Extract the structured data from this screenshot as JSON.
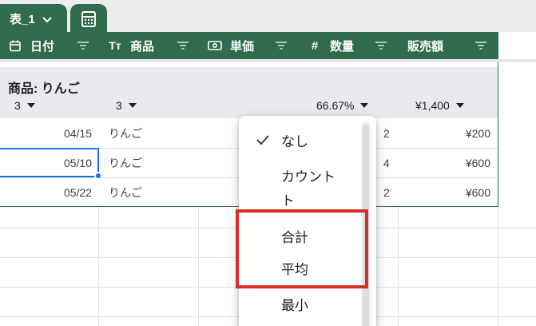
{
  "tab": {
    "name": "表_1"
  },
  "columns": [
    {
      "name": "日付",
      "icon": "calendar-icon"
    },
    {
      "name": "商品",
      "icon": "text-type-icon",
      "icon_text": "Tт"
    },
    {
      "name": "単価",
      "icon": "money-icon"
    },
    {
      "name": "数量",
      "icon": "number-icon",
      "icon_text": "#"
    },
    {
      "name": "販売額",
      "icon": "none"
    }
  ],
  "group": {
    "title": "商品: りんご",
    "agg_date": "3",
    "agg_item": "3",
    "agg_qty": "66.67%",
    "agg_sales": "¥1,400"
  },
  "rows": [
    {
      "date": "04/15",
      "item": "りんご",
      "qty": "2",
      "sales": "¥200"
    },
    {
      "date": "05/10",
      "item": "りんご",
      "qty": "4",
      "sales": "¥600"
    },
    {
      "date": "05/22",
      "item": "りんご",
      "qty": "2",
      "sales": "¥600"
    }
  ],
  "menu": {
    "items": [
      {
        "label": "なし",
        "checked": true
      },
      {
        "label": "カウント"
      },
      {
        "label": "ト"
      },
      {
        "label": "合計"
      },
      {
        "label": "平均"
      },
      {
        "label": "最小"
      }
    ]
  },
  "colors": {
    "header_green": "#2f6b4c",
    "highlight_red": "#d93025",
    "selection_blue": "#1a73e8"
  }
}
